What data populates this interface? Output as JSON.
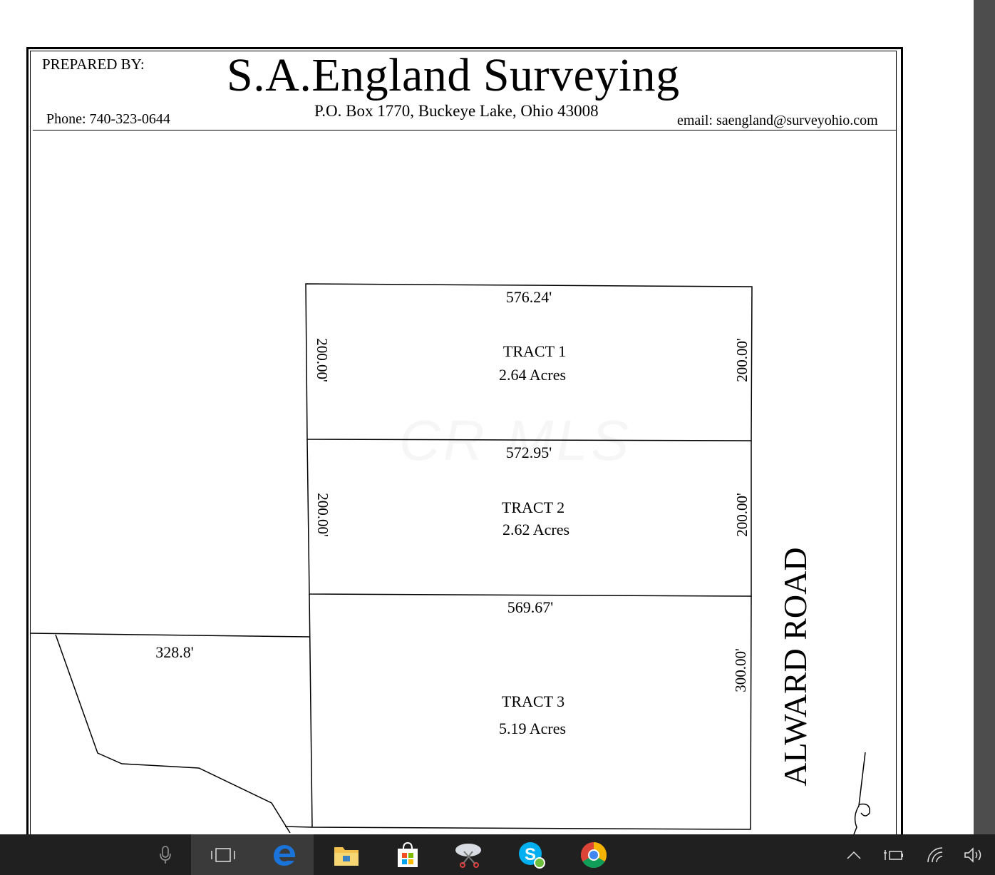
{
  "header": {
    "prepared_by": "PREPARED BY:",
    "company": "S.A.England Surveying",
    "address": "P.O. Box 1770, Buckeye Lake, Ohio  43008",
    "phone": "Phone: 740-323-0644",
    "email": "email: saengland@surveyohio.com"
  },
  "plat": {
    "tract1": {
      "name": "TRACT 1",
      "acres": "2.64 Acres",
      "top": "576.24'",
      "left": "200.00'",
      "right": "200.00'"
    },
    "tract2": {
      "name": "TRACT 2",
      "acres": "2.62 Acres",
      "top": "572.95'",
      "left": "200.00'",
      "right": "200.00'"
    },
    "tract3": {
      "name": "TRACT 3",
      "acres": "5.19 Acres",
      "top": "569.67'",
      "right": "300.00'"
    },
    "adjacent_dimension": "328.8'",
    "road_name": "ALWARD ROAD"
  },
  "watermark": "CR MLS",
  "taskbar": {
    "background": "#202020",
    "items": [
      "microphone-icon",
      "task-view-icon",
      "edge-icon",
      "file-explorer-icon",
      "store-icon",
      "snipping-tool-icon",
      "skype-icon",
      "chrome-icon"
    ],
    "tray": [
      "chevron-up-icon",
      "battery-icon",
      "wifi-icon",
      "volume-icon"
    ]
  }
}
